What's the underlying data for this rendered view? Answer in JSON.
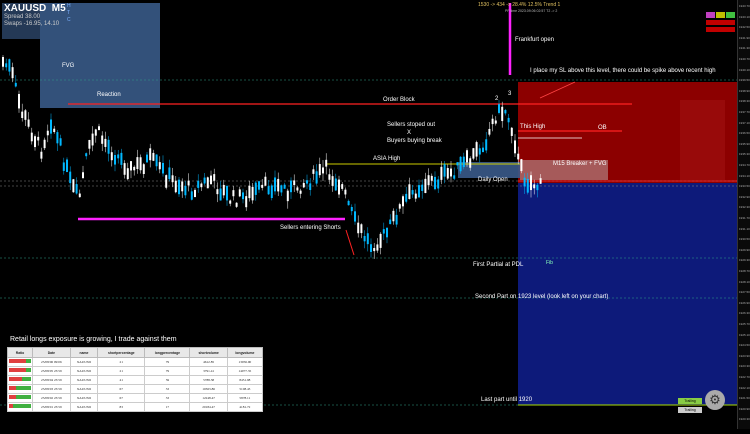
{
  "symbol": {
    "name": "XAUUSD",
    "timeframe": "M5"
  },
  "spread": {
    "spread_line": "Spread 38.00",
    "swaps_line": "Swaps -16.95, 14.10"
  },
  "side_letters": [
    "H",
    "T",
    "C"
  ],
  "top_stats": "1530 -> 434 -> 28.4%  12.5%  Trend 1",
  "top_sub": "PF  time 2023.09.06 02:57 T2 -> 2",
  "annotations": {
    "fvg": "FVG",
    "reaction": "Reaction",
    "frankfurt": "Frankfurt open",
    "sl_note": "I place my SL above this level, there could be spike above recent high",
    "order_block": "Order Block",
    "num2": "2",
    "num3": "3",
    "this_high": "This High",
    "ob": "OB",
    "sellers_stoped": "Sellers stoped out",
    "x": "X",
    "buyers_break": "Buyers buying break",
    "asia_high": "ASIA High",
    "m15": "M15 Breaker + FVG",
    "daily_open": "Daily Open",
    "sellers_entering": "Sellers entering Shorts",
    "first_partial": "First Partial at PDL",
    "fib_small": "Fib",
    "second_part": "Second Part on 1923 level (look left on your chart)",
    "last_part": "Last part until 1920"
  },
  "panel": {
    "title": "Retail longs exposure is growing, I trade against them",
    "columns": [
      "Ratio",
      "Date",
      "name",
      "shortpercentage",
      "longpercentage",
      "shortvolume",
      "longvolume"
    ],
    "rows": [
      {
        "date": "23/08/06 09:06",
        "name": "XAUUSD",
        "short": "21",
        "long": "79",
        "sv": "4612.85",
        "lv": "13056.90",
        "ratio": 0.79
      },
      {
        "date": "23/08/05 23:59",
        "name": "XAUUSD",
        "short": "21",
        "long": "79",
        "sv": "3791.41",
        "lv": "14077.35",
        "ratio": 0.79
      },
      {
        "date": "23/08/04 23:59",
        "name": "XAUUSD",
        "short": "41",
        "long": "59",
        "sv": "5788.38",
        "lv": "8451.98",
        "ratio": 0.59
      },
      {
        "date": "23/08/03 23:59",
        "name": "XAUUSD",
        "short": "67",
        "long": "33",
        "sv": "10363.86",
        "lv": "5108.43",
        "ratio": 0.33
      },
      {
        "date": "23/08/02 23:59",
        "name": "XAUUSD",
        "short": "67",
        "long": "33",
        "sv": "12248.47",
        "lv": "5878.11",
        "ratio": 0.33
      },
      {
        "date": "23/08/01 23:59",
        "name": "XAUUSD",
        "short": "83",
        "long": "17",
        "sv": "20184.47",
        "lv": "4181.72",
        "ratio": 0.17
      }
    ]
  },
  "price_axis_ticks": [
    "1943.70",
    "1943.10",
    "1942.50",
    "1941.90",
    "1941.30",
    "1940.70",
    "1940.10",
    "1939.50",
    "1938.90",
    "1938.30",
    "1937.70",
    "1937.10",
    "1936.50",
    "1935.90",
    "1935.30",
    "1934.70",
    "1934.10",
    "1933.50",
    "1932.90",
    "1932.30",
    "1931.70",
    "1931.10",
    "1930.50",
    "1929.90",
    "1929.30",
    "1928.70",
    "1928.10",
    "1927.50",
    "1926.90",
    "1926.30",
    "1925.70",
    "1925.10",
    "1924.50",
    "1923.90",
    "1923.30",
    "1922.70",
    "1922.10",
    "1921.50",
    "1920.90",
    "1920.30"
  ],
  "bottom_right": {
    "btn1": "Trailing",
    "btn2": "Trailing"
  },
  "colors": {
    "bull": "#00b8ff",
    "bear": "#ffffff",
    "magenta": "#ff22ff",
    "red_zone": "#8c0000",
    "blue_zone": "#0d1a7a",
    "fvg_box": "#33517a"
  }
}
